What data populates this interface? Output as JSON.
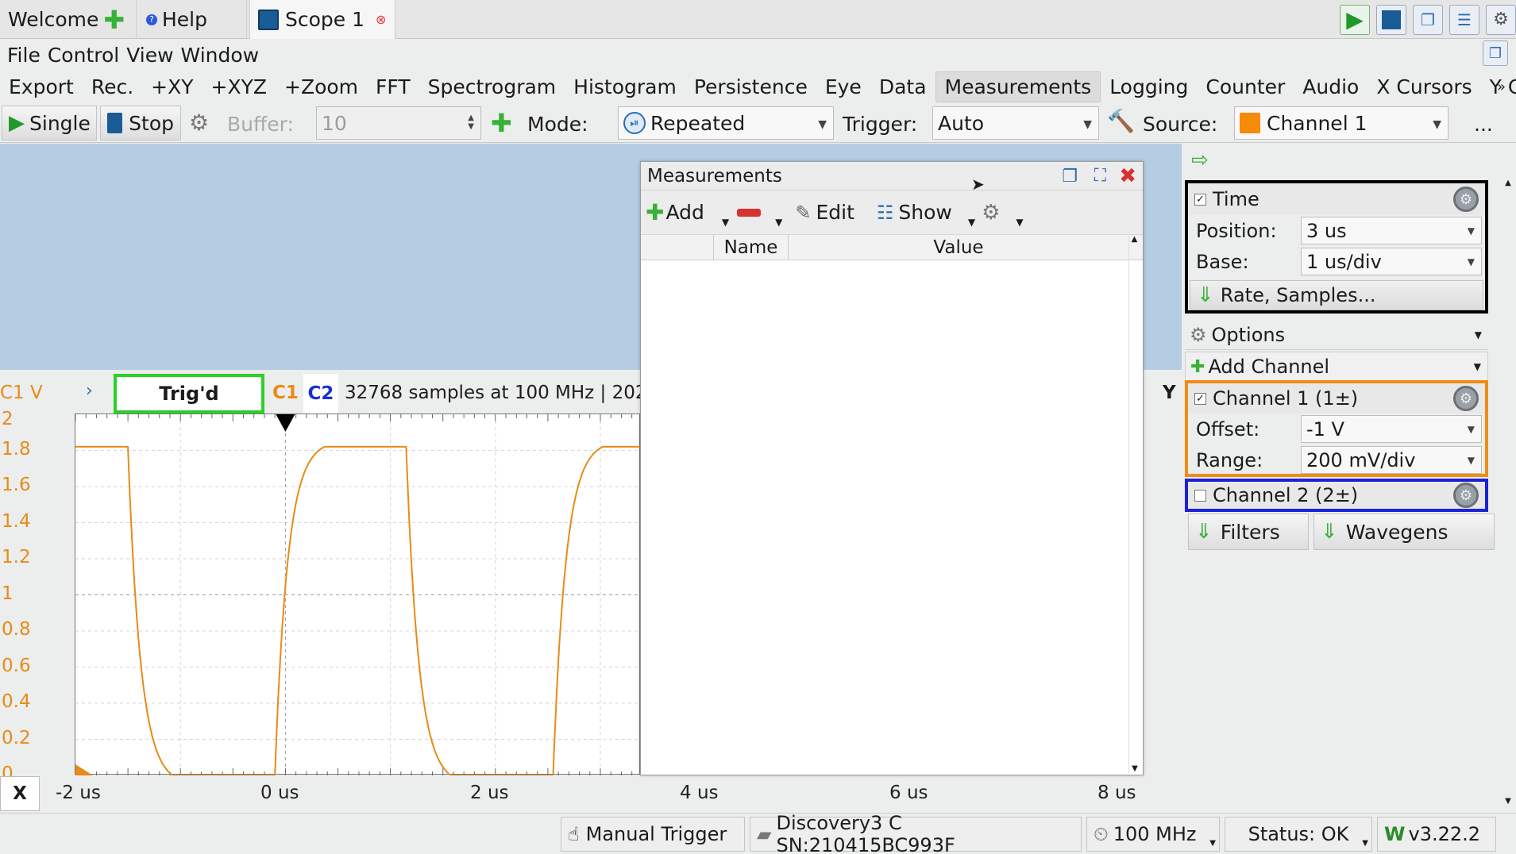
{
  "tabs": {
    "welcome": "Welcome",
    "help": "Help",
    "scope": "Scope 1"
  },
  "menu": {
    "file": "File",
    "control": "Control",
    "view": "View",
    "window": "Window"
  },
  "toolbar": [
    "Export",
    "Rec.",
    "+XY",
    "+XYZ",
    "+Zoom",
    "FFT",
    "Spectrogram",
    "Histogram",
    "Persistence",
    "Eye",
    "Data",
    "Measurements",
    "Logging",
    "Counter",
    "Audio",
    "X Cursors",
    "Y Cursors"
  ],
  "toolbar_active": "Measurements",
  "controls": {
    "single": "Single",
    "stop": "Stop",
    "buffer_label": "Buffer:",
    "buffer_value": "10",
    "mode_label": "Mode:",
    "mode_value": "Repeated",
    "trigger_label": "Trigger:",
    "trigger_value": "Auto",
    "source_label": "Source:",
    "source_value": "Channel 1",
    "more": "..."
  },
  "scope": {
    "c1_unit": "C1 V",
    "trig": "Trig'd",
    "c1": "C1",
    "c2": "C2",
    "info": "32768 samples at 100 MHz | 202",
    "y_label": "Y",
    "x_label": "X",
    "y_ticks": [
      "2",
      "1.8",
      "1.6",
      "1.4",
      "1.2",
      "1",
      "0.8",
      "0.6",
      "0.4",
      "0.2",
      "0"
    ],
    "x_ticks": [
      "-2 us",
      "0 us",
      "2 us",
      "4 us",
      "6 us",
      "8 us"
    ]
  },
  "chart_data": {
    "type": "line",
    "series": [
      {
        "name": "C1",
        "color": "#e88b17",
        "x_range_us": [
          -2,
          3.4
        ],
        "high_v": 1.82,
        "low_v": 0.0
      }
    ],
    "xlim": [
      -2,
      8
    ],
    "ylim": [
      0,
      2
    ],
    "grid": true
  },
  "measurements": {
    "title": "Measurements",
    "add": "Add",
    "edit": "Edit",
    "show": "Show",
    "col_name": "Name",
    "col_value": "Value"
  },
  "panel": {
    "time": "Time",
    "position_label": "Position:",
    "position_value": "3 us",
    "base_label": "Base:",
    "base_value": "1 us/div",
    "rate": "Rate, Samples...",
    "options": "Options",
    "add_channel": "Add Channel",
    "ch1": "Channel 1 (1±)",
    "offset_label": "Offset:",
    "offset_value": "-1 V",
    "range_label": "Range:",
    "range_value": "200 mV/div",
    "ch2": "Channel 2 (2±)",
    "filters": "Filters",
    "wavegens": "Wavegens"
  },
  "status": {
    "manual": "Manual Trigger",
    "device": "Discovery3 C SN:210415BC993F",
    "freq": "100 MHz",
    "status": "Status: OK",
    "version": "v3.22.2"
  },
  "colors": {
    "c1": "#e88b17",
    "c2": "#1b2fd1",
    "trig_box": "#2bd02b",
    "time_box": "#000000",
    "ch2_box": "#1a22d8"
  }
}
